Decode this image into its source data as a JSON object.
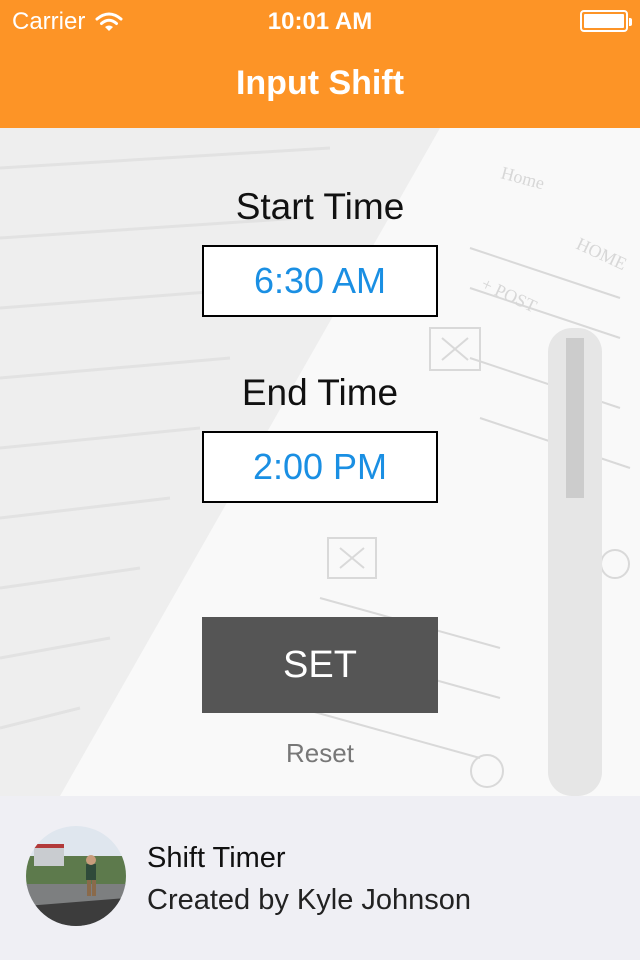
{
  "status_bar": {
    "carrier": "Carrier",
    "time": "10:01 AM"
  },
  "nav": {
    "title": "Input Shift"
  },
  "form": {
    "start_label": "Start Time",
    "start_value": "6:30 AM",
    "end_label": "End Time",
    "end_value": "2:00 PM",
    "set_label": "SET",
    "reset_label": "Reset"
  },
  "footer": {
    "app_name": "Shift Timer",
    "credit": "Created by Kyle Johnson"
  },
  "colors": {
    "header": "#fd9426",
    "time_value": "#1a8fe3",
    "button": "#555555",
    "footer": "#efeff4"
  },
  "icons": [
    "wifi-icon",
    "battery-icon"
  ]
}
